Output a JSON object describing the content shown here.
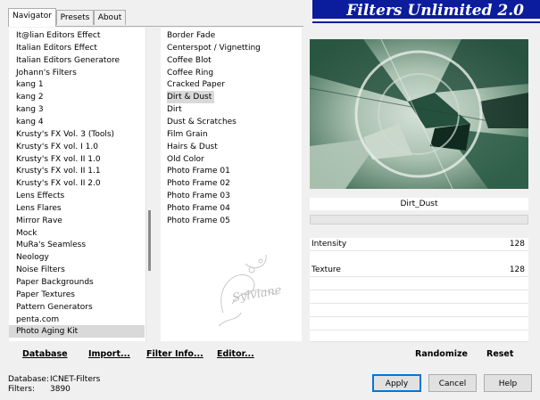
{
  "tabs": [
    "Navigator",
    "Presets",
    "About"
  ],
  "banner_title": "Filters Unlimited 2.0",
  "categories": [
    "It@lian Editors Effect",
    "Italian Editors Effect",
    "Italian Editors Generatore",
    "Johann's Filters",
    "kang 1",
    "kang 2",
    "kang 3",
    "kang 4",
    "Krusty's FX Vol. 3 (Tools)",
    "Krusty's FX vol. I 1.0",
    "Krusty's FX vol. II 1.0",
    "Krusty's FX vol. II 1.1",
    "Krusty's FX vol. II 2.0",
    "Lens Effects",
    "Lens Flares",
    "Mirror Rave",
    "Mock",
    "MuRa's Seamless",
    "Neology",
    "Noise Filters",
    "Paper Backgrounds",
    "Paper Textures",
    "Pattern Generators",
    "penta.com",
    "Photo Aging Kit"
  ],
  "selected_category": "Photo Aging Kit",
  "filters": [
    "Border Fade",
    "Centerspot / Vignetting",
    "Coffee Blot",
    "Coffee Ring",
    "Cracked Paper",
    "Dirt & Dust",
    "Dirt",
    "Dust & Scratches",
    "Film Grain",
    "Hairs & Dust",
    "Old Color",
    "Photo Frame 01",
    "Photo Frame 02",
    "Photo Frame 03",
    "Photo Frame 04",
    "Photo Frame 05"
  ],
  "selected_filter": "Dirt & Dust",
  "watermark": "Sylviane",
  "preset_name": "Dirt_Dust",
  "params": [
    {
      "label": "Intensity",
      "value": "128"
    },
    {
      "label": "Texture",
      "value": "128"
    }
  ],
  "links": {
    "database": "Database",
    "import": "Import...",
    "filter_info": "Filter Info...",
    "editor": "Editor...",
    "randomize": "Randomize",
    "reset": "Reset"
  },
  "status": {
    "database_label": "Database:",
    "database_value": "ICNET-Filters",
    "filters_label": "Filters:",
    "filters_value": "3890"
  },
  "buttons": {
    "apply": "Apply",
    "cancel": "Cancel",
    "help": "Help"
  },
  "colors": {
    "banner": "#0b1c9c",
    "preview_dark": "#1f4a38",
    "preview_light": "#dfe8e0"
  }
}
